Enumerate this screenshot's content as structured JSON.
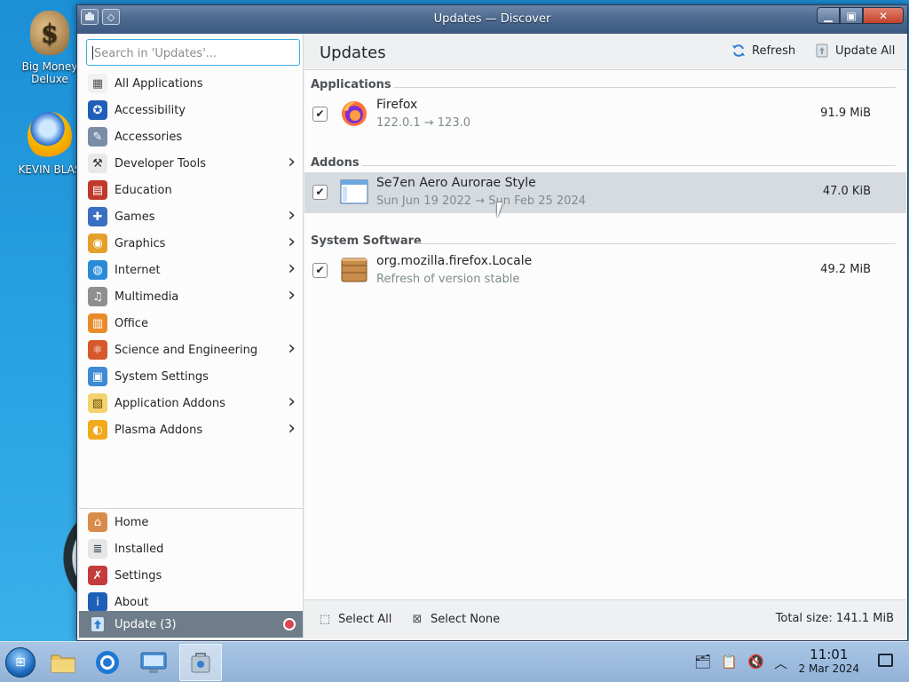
{
  "desktop": {
    "icons": [
      {
        "label": "Big Money\nDeluxe",
        "icon": "money-bag-icon"
      },
      {
        "label": "KEVIN BLAS",
        "icon": "sun-globe-icon"
      }
    ]
  },
  "window": {
    "title": "Updates — Discover",
    "controls": {
      "minimize": "▁",
      "maximize": "▣",
      "close": "✕"
    }
  },
  "sidebar": {
    "search_placeholder": "Search in 'Updates'...",
    "categories": [
      {
        "label": "All Applications",
        "icon": "grid-icon",
        "has_children": false
      },
      {
        "label": "Accessibility",
        "icon": "accessibility-icon",
        "has_children": false
      },
      {
        "label": "Accessories",
        "icon": "accessories-icon",
        "has_children": false
      },
      {
        "label": "Developer Tools",
        "icon": "developer-tools-icon",
        "has_children": true
      },
      {
        "label": "Education",
        "icon": "education-icon",
        "has_children": false
      },
      {
        "label": "Games",
        "icon": "games-icon",
        "has_children": true
      },
      {
        "label": "Graphics",
        "icon": "graphics-icon",
        "has_children": true
      },
      {
        "label": "Internet",
        "icon": "internet-icon",
        "has_children": true
      },
      {
        "label": "Multimedia",
        "icon": "multimedia-icon",
        "has_children": true
      },
      {
        "label": "Office",
        "icon": "office-icon",
        "has_children": false
      },
      {
        "label": "Science and Engineering",
        "icon": "science-icon",
        "has_children": true
      },
      {
        "label": "System Settings",
        "icon": "system-settings-icon",
        "has_children": false
      },
      {
        "label": "Application Addons",
        "icon": "application-addons-icon",
        "has_children": true
      },
      {
        "label": "Plasma Addons",
        "icon": "plasma-addons-icon",
        "has_children": true
      }
    ],
    "bottom": [
      {
        "label": "Home",
        "icon": "home-icon"
      },
      {
        "label": "Installed",
        "icon": "installed-icon"
      },
      {
        "label": "Settings",
        "icon": "settings-icon"
      },
      {
        "label": "About",
        "icon": "about-icon"
      }
    ],
    "update_item": {
      "label": "Update (3)",
      "icon": "update-icon"
    }
  },
  "main": {
    "title": "Updates",
    "refresh_label": "Refresh",
    "update_all_label": "Update All",
    "sections": [
      {
        "title": "Applications",
        "items": [
          {
            "name": "Firefox",
            "version": "122.0.1 → 123.0",
            "size": "91.9 MiB",
            "checked": true,
            "icon": "firefox-icon"
          }
        ]
      },
      {
        "title": "Addons",
        "items": [
          {
            "name": "Se7en Aero Aurorae Style",
            "version": "Sun Jun 19 2022 → Sun Feb 25 2024",
            "size": "47.0 KiB",
            "checked": true,
            "icon": "window-theme-icon"
          }
        ]
      },
      {
        "title": "System Software",
        "items": [
          {
            "name": "org.mozilla.firefox.Locale",
            "version": "Refresh of version stable",
            "size": "49.2 MiB",
            "checked": true,
            "icon": "package-icon"
          }
        ]
      }
    ],
    "footer": {
      "select_all_label": "Select All",
      "select_none_label": "Select None",
      "total_size": "Total size: 141.1 MiB"
    }
  },
  "taskbar": {
    "clock_time": "11:01",
    "clock_date": "2 Mar 2024"
  },
  "colors": {
    "accent": "#3daee9",
    "selected_sidebar": "#6e7d89",
    "titlebar": "#4d6a8f",
    "badge": "#da4453"
  }
}
